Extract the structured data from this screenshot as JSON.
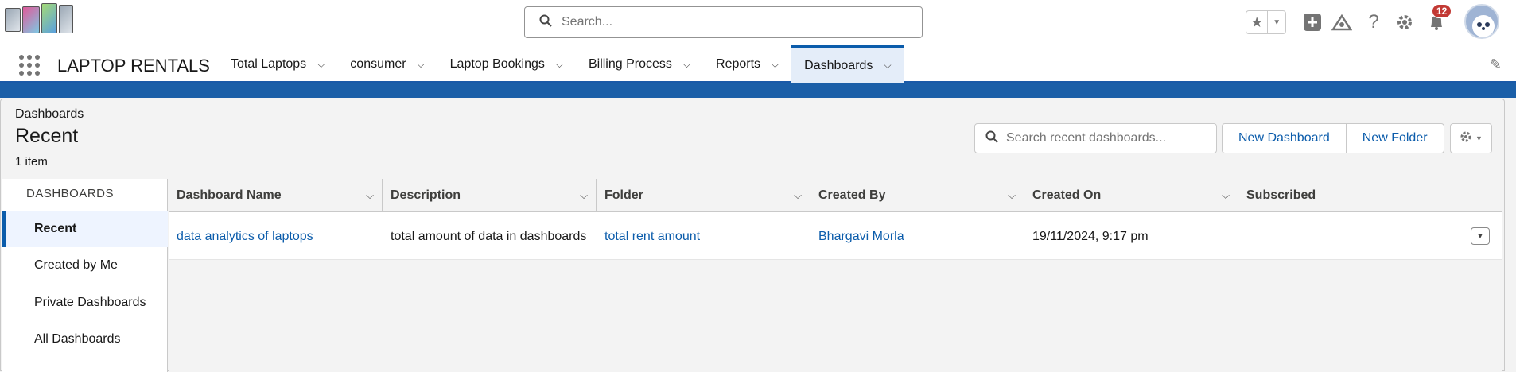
{
  "header": {
    "search_placeholder": "Search...",
    "notification_count": "12"
  },
  "nav": {
    "app_name": "LAPTOP RENTALS",
    "tabs": [
      {
        "label": "Total Laptops"
      },
      {
        "label": "consumer"
      },
      {
        "label": "Laptop Bookings"
      },
      {
        "label": "Billing Process"
      },
      {
        "label": "Reports"
      },
      {
        "label": "Dashboards"
      }
    ]
  },
  "page": {
    "breadcrumb": "Dashboards",
    "title": "Recent",
    "item_count": "1 item",
    "search_placeholder": "Search recent dashboards...",
    "new_dashboard_label": "New Dashboard",
    "new_folder_label": "New Folder"
  },
  "sidebar": {
    "title": "DASHBOARDS",
    "items": [
      {
        "label": "Recent"
      },
      {
        "label": "Created by Me"
      },
      {
        "label": "Private Dashboards"
      },
      {
        "label": "All Dashboards"
      }
    ]
  },
  "table": {
    "columns": [
      "Dashboard Name",
      "Description",
      "Folder",
      "Created By",
      "Created On",
      "Subscribed"
    ],
    "rows": [
      {
        "name": "data analytics of laptops",
        "description": "total amount of data in dashboards",
        "folder": "total rent amount",
        "created_by": "Bhargavi Morla",
        "created_on": "19/11/2024, 9:17 pm",
        "subscribed": ""
      }
    ]
  },
  "colors": {
    "brand_blue": "#0b5cab",
    "band_blue": "#1b5fa8",
    "badge_red": "#c23934"
  }
}
